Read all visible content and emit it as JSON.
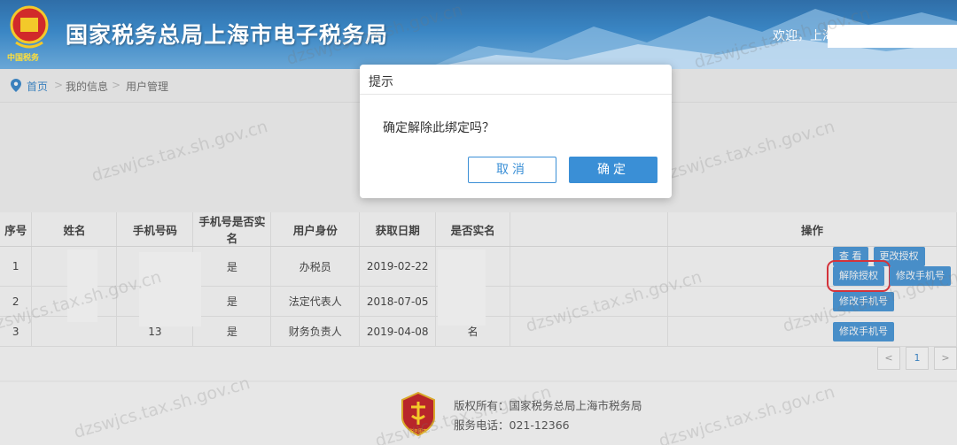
{
  "header": {
    "title": "国家税务总局上海市电子税务局",
    "emblem_subtitle": "中国税务",
    "welcome": "欢迎，上海",
    "colors": {
      "top": "#2f6ea8",
      "bottom": "#6aa7d6"
    }
  },
  "breadcrumb": {
    "home": "首页",
    "separator": ">",
    "level1": "我的信息",
    "level2": "用户管理"
  },
  "dialog": {
    "title": "提示",
    "message": "确定解除此绑定吗？",
    "cancel_label": "取消",
    "ok_label": "确定"
  },
  "table": {
    "headers": [
      "序号",
      "姓名",
      "手机号码",
      "手机号是否实名",
      "用户身份",
      "获取日期",
      "是否实名",
      "",
      "操作"
    ],
    "rows": [
      {
        "index": "1",
        "name": "",
        "phone": "13",
        "phone_verified": "是",
        "role": "办税员",
        "date": "2019-02-22",
        "verified": "名",
        "actions": [
          "查 看",
          "更改授权",
          "解除授权",
          "修改手机号"
        ]
      },
      {
        "index": "2",
        "name": "",
        "phone": "13",
        "phone_verified": "是",
        "role": "法定代表人",
        "date": "2018-07-05",
        "verified": "名",
        "actions": [
          "修改手机号"
        ]
      },
      {
        "index": "3",
        "name": "",
        "phone": "13",
        "phone_verified": "是",
        "role": "财务负责人",
        "date": "2019-04-08",
        "verified": "名",
        "actions": [
          "修改手机号"
        ]
      }
    ]
  },
  "pager": {
    "prev": "<",
    "current": "1",
    "next": ">"
  },
  "footer": {
    "copyright": "版权所有：国家税务总局上海市税务局",
    "phone": "服务电话：021-12366",
    "logo_caption": "税务图案"
  },
  "watermark": "dzswjcs.tax.sh.gov.cn",
  "accent_color": "#3a8fd6",
  "highlight_color": "#e3202a"
}
